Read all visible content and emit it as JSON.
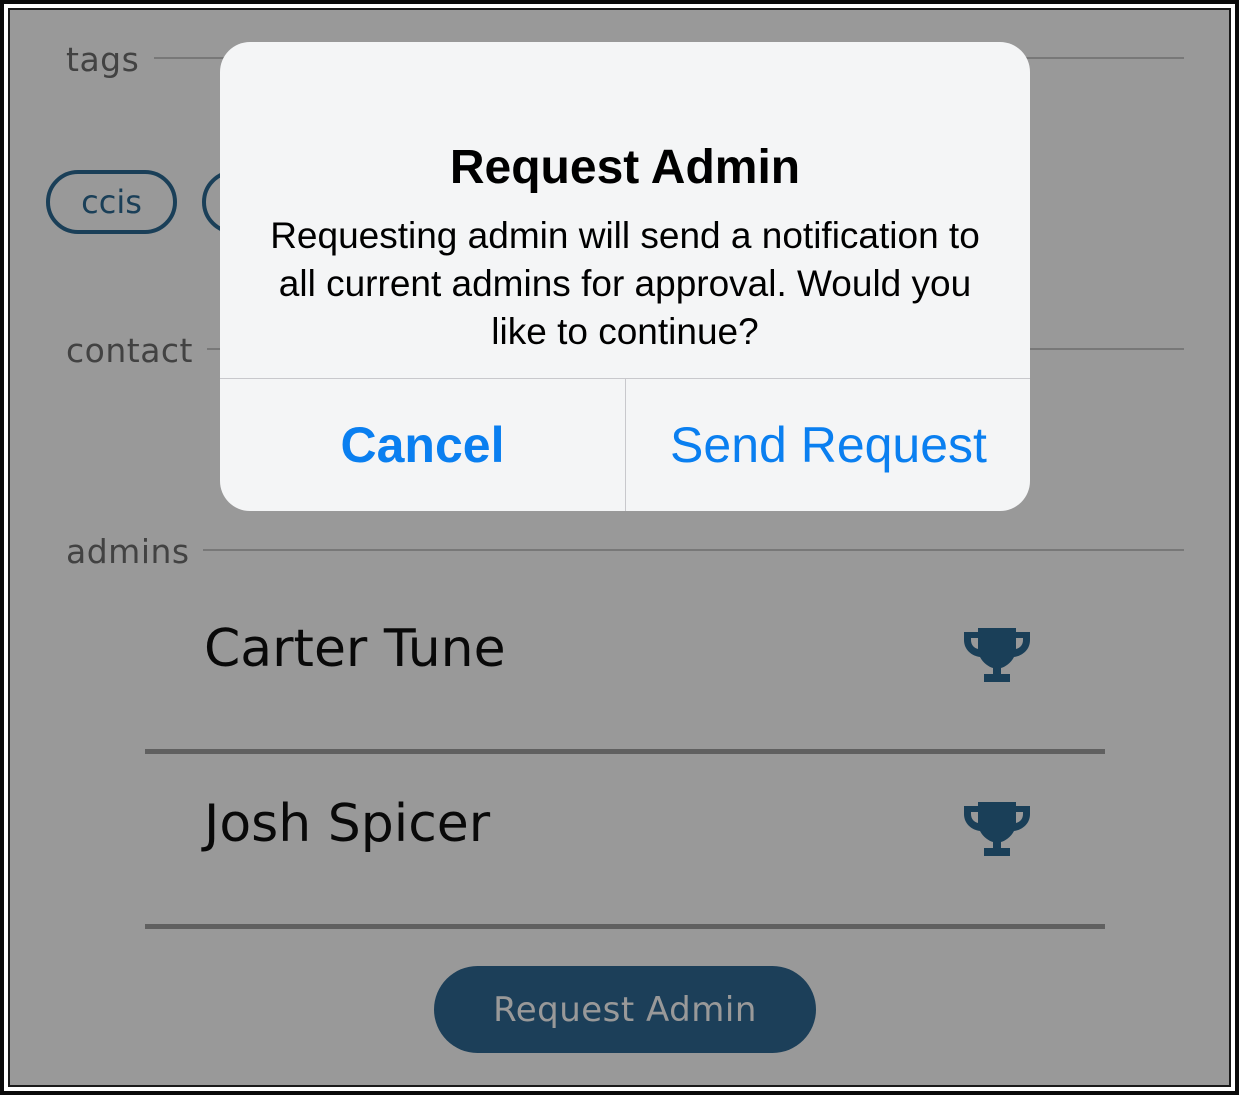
{
  "sections": {
    "tags": "tags",
    "contact": "contact",
    "admins": "admins"
  },
  "tags": [
    "ccis"
  ],
  "admins": [
    {
      "name": "Carter Tune",
      "icon": "trophy-icon"
    },
    {
      "name": "Josh Spicer",
      "icon": "trophy-icon"
    }
  ],
  "request_button": "Request Admin",
  "alert": {
    "title": "Request Admin",
    "message": "Requesting admin will send a notification to all current admins for approval. Would you like to continue?",
    "cancel": "Cancel",
    "send": "Send Request"
  },
  "colors": {
    "accent": "#2c6a93",
    "button_blue": "#0a7ff0",
    "overlay": "rgba(0,0,0,0.40)"
  }
}
